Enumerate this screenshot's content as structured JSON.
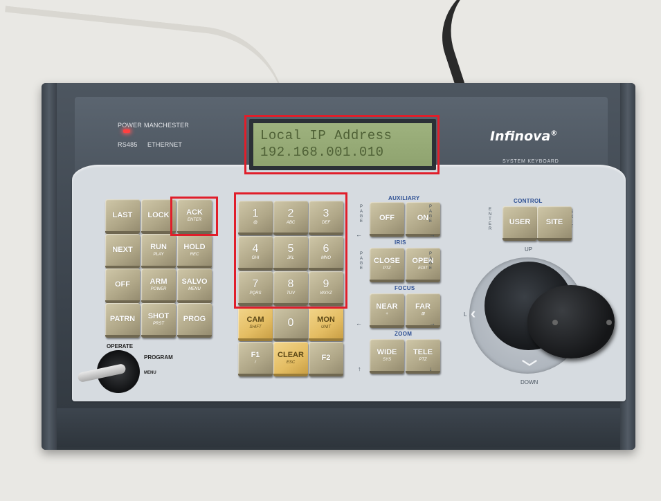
{
  "status": {
    "power": "POWER",
    "manchester": "MANCHESTER",
    "rs485": "RS485",
    "ethernet": "ETHERNET"
  },
  "lcd": {
    "line1": "Local IP Address",
    "line2": "192.168.001.010"
  },
  "brand": {
    "name": "Infinova",
    "sub": "SYSTEM KEYBOARD"
  },
  "colors": {
    "highlight": "#e01e2a",
    "lcd_bg": "#9eb27e",
    "key": "#b8af90",
    "key_yellow": "#e4bd63",
    "group_label": "#2d4f93"
  },
  "function_keys": [
    {
      "label": "LAST",
      "sub": ""
    },
    {
      "label": "LOCK",
      "sub": ""
    },
    {
      "label": "ACK",
      "sub": "ENTER"
    },
    {
      "label": "NEXT",
      "sub": ""
    },
    {
      "label": "RUN",
      "sub": "PLAY"
    },
    {
      "label": "HOLD",
      "sub": "REC"
    },
    {
      "label": "OFF",
      "sub": ""
    },
    {
      "label": "ARM",
      "sub": "POWER"
    },
    {
      "label": "SALVO",
      "sub": "MENU"
    },
    {
      "label": "PATRN",
      "sub": ""
    },
    {
      "label": "SHOT",
      "sub": "PRST"
    },
    {
      "label": "PROG",
      "sub": ""
    }
  ],
  "numpad": [
    {
      "num": "1",
      "sub": "@"
    },
    {
      "num": "2",
      "sub": "ABC"
    },
    {
      "num": "3",
      "sub": "DEF"
    },
    {
      "num": "4",
      "sub": "GHI"
    },
    {
      "num": "5",
      "sub": "JKL"
    },
    {
      "num": "6",
      "sub": "MNO"
    },
    {
      "num": "7",
      "sub": "PQRS"
    },
    {
      "num": "8",
      "sub": "TUV"
    },
    {
      "num": "9",
      "sub": "WXYZ"
    },
    {
      "num": "CAM",
      "sub": "SHIFT"
    },
    {
      "num": "0",
      "sub": ""
    },
    {
      "num": "MON",
      "sub": "UNIT"
    },
    {
      "num": "F1",
      "sub": "/"
    },
    {
      "num": "CLEAR",
      "sub": "ESC"
    },
    {
      "num": "F2",
      "sub": ""
    }
  ],
  "groups": {
    "auxiliary": {
      "title": "AUXILIARY",
      "left": "OFF",
      "right": "ON"
    },
    "iris": {
      "title": "IRIS",
      "left": "CLOSE",
      "left_sub": "PTZ",
      "right": "OPEN",
      "right_sub": "EDIT"
    },
    "focus": {
      "title": "FOCUS",
      "left": "NEAR",
      "left_sub": "+",
      "right": "FAR",
      "right_sub": "⊞"
    },
    "zoom": {
      "title": "ZOOM",
      "left": "WIDE",
      "left_sub": "SYS",
      "right": "TELE",
      "right_sub": "PTZ"
    },
    "control": {
      "title": "CONTROL",
      "left": "USER",
      "right": "SITE"
    }
  },
  "side_labels": {
    "page": "PAGE",
    "enter": "ENTER",
    "exit": "EXIT"
  },
  "joystick": {
    "up": "UP",
    "down": "DOWN",
    "left": "L"
  },
  "keyswitch": {
    "operate": "OPERATE",
    "program": "PROGRAM",
    "menu": "MENU"
  }
}
